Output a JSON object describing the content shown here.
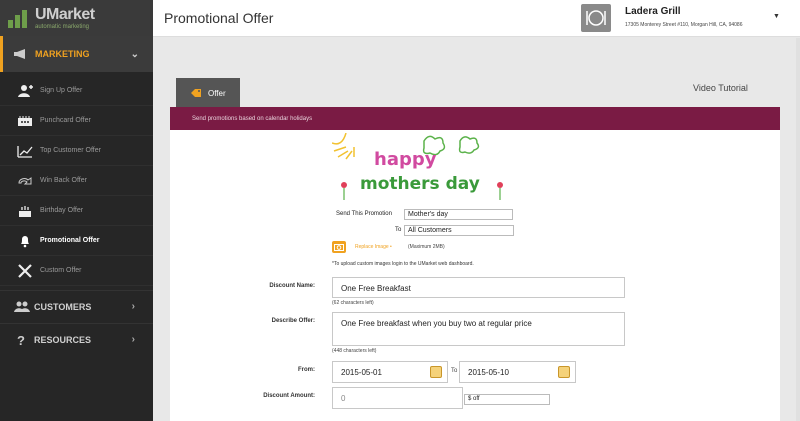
{
  "brand": {
    "title": "UMarket",
    "subtitle": "automatic marketing"
  },
  "sidebar": {
    "main": {
      "label": "MARKETING"
    },
    "items": [
      {
        "label": "Sign Up Offer",
        "icon": "sign-up-icon"
      },
      {
        "label": "Punchcard Offer",
        "icon": "punchcard-icon"
      },
      {
        "label": "Top Customer Offer",
        "icon": "top-customer-icon"
      },
      {
        "label": "Win Back Offer",
        "icon": "win-back-icon"
      },
      {
        "label": "Birthday Offer",
        "icon": "birthday-cake-icon"
      },
      {
        "label": "Promotional Offer",
        "icon": "bell-icon"
      },
      {
        "label": "Custom Offer",
        "icon": "tools-icon"
      }
    ],
    "sections": [
      {
        "label": "CUSTOMERS",
        "icon": "customers-icon"
      },
      {
        "label": "RESOURCES",
        "icon": "question-icon"
      }
    ]
  },
  "header": {
    "title": "Promotional Offer",
    "business_name": "Ladera Grill",
    "business_address": "17305 Monterey Street #110, Morgan Hill, CA, 94086"
  },
  "tabs": {
    "offer_label": "Offer",
    "video_tutorial": "Video Tutorial"
  },
  "banner": {
    "text": "Send promotions based on calendar holidays"
  },
  "image": {
    "line1": "happy",
    "line2": "mothers day"
  },
  "promotion": {
    "send_label": "Send This Promotion",
    "send_value": "Mother's day",
    "to_label": "To",
    "to_value": "All Customers",
    "replace_link": "Replace Image •",
    "replace_max": "(Maximum 2MB)",
    "upload_note": "*To upload custom images login to the UMarket web dashboard."
  },
  "form": {
    "discount_name_label": "Discount Name:",
    "discount_name_value": "One Free Breakfast",
    "discount_name_hint": "(62 characters left)",
    "describe_label": "Describe Offer:",
    "describe_value": "One Free breakfast when you buy two at regular price",
    "describe_hint": "(448 characters left)",
    "from_label": "From:",
    "from_value": "2015-05-01",
    "to_label": "To",
    "to_value": "2015-05-10",
    "amount_label": "Discount Amount:",
    "amount_value": "0",
    "amount_suffix": "$ off"
  },
  "colors": {
    "accent": "#f0a220",
    "banner": "#7a1b44",
    "sidebar": "#262626"
  }
}
